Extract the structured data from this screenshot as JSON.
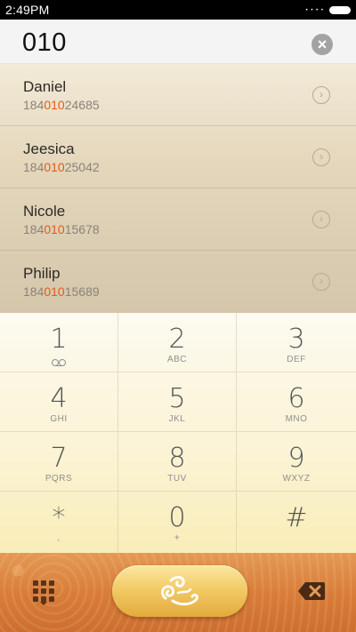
{
  "status_bar": {
    "time": "2:49PM",
    "signal": "• • • •"
  },
  "search": {
    "query": "010",
    "clear_icon": "clear-circle-icon"
  },
  "contacts": [
    {
      "name": "Daniel",
      "number_prefix": "184",
      "number_match": "010",
      "number_suffix": "24685"
    },
    {
      "name": "Jeesica",
      "number_prefix": "184",
      "number_match": "010",
      "number_suffix": "25042"
    },
    {
      "name": "Nicole",
      "number_prefix": "184",
      "number_match": "010",
      "number_suffix": "15678"
    },
    {
      "name": "Philip",
      "number_prefix": "184",
      "number_match": "010",
      "number_suffix": "15689"
    }
  ],
  "keypad": [
    {
      "digit": "1",
      "letters": ""
    },
    {
      "digit": "2",
      "letters": "ABC"
    },
    {
      "digit": "3",
      "letters": "DEF"
    },
    {
      "digit": "4",
      "letters": "GHI"
    },
    {
      "digit": "5",
      "letters": "JKL"
    },
    {
      "digit": "6",
      "letters": "MNO"
    },
    {
      "digit": "7",
      "letters": "PQRS"
    },
    {
      "digit": "8",
      "letters": "TUV"
    },
    {
      "digit": "9",
      "letters": "WXYZ"
    },
    {
      "digit": "*",
      "letters": ","
    },
    {
      "digit": "0",
      "letters": "+"
    },
    {
      "digit": "#",
      "letters": ""
    }
  ],
  "bottom_bar": {
    "keypad_icon": "dialpad-grid-icon",
    "call_icon": "call-ornament-icon",
    "backspace_icon": "backspace-icon"
  },
  "colors": {
    "match_highlight": "#e35a1a",
    "bottom_bar": "#d97d3a",
    "call_button": "#f1c862"
  }
}
